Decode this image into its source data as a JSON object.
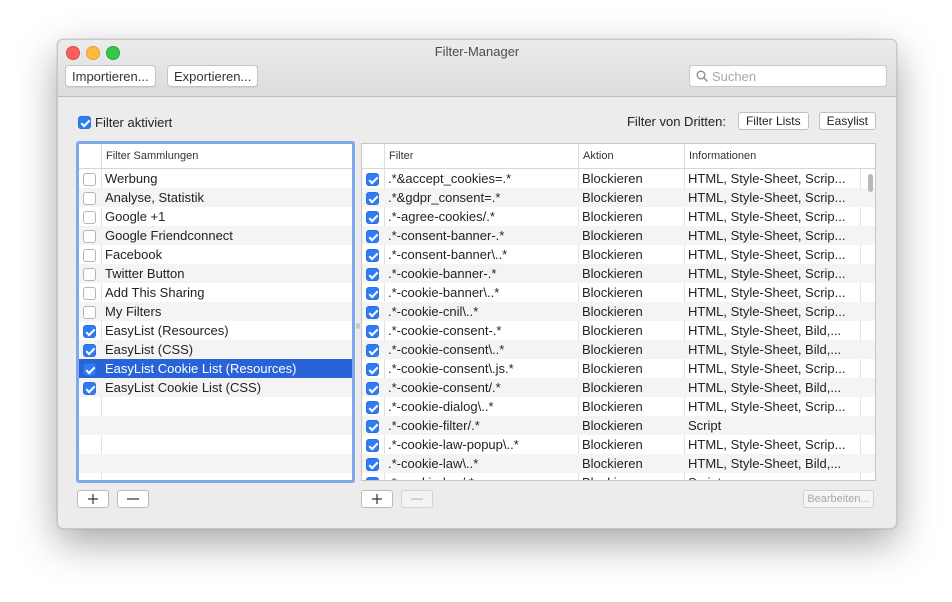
{
  "window": {
    "title": "Filter-Manager"
  },
  "toolbar": {
    "import_label": "Importieren...",
    "export_label": "Exportieren...",
    "search_placeholder": "Suchen"
  },
  "filter_enabled": {
    "label": "Filter aktiviert",
    "checked": true
  },
  "third_party": {
    "label": "Filter von Dritten:",
    "buttons": [
      "Filter Lists",
      "Easylist"
    ]
  },
  "collections": {
    "header": "Filter Sammlungen",
    "items": [
      {
        "label": "Werbung",
        "checked": false
      },
      {
        "label": "Analyse, Statistik",
        "checked": false
      },
      {
        "label": "Google +1",
        "checked": false
      },
      {
        "label": "Google Friendconnect",
        "checked": false
      },
      {
        "label": "Facebook",
        "checked": false
      },
      {
        "label": "Twitter Button",
        "checked": false
      },
      {
        "label": "Add This Sharing",
        "checked": false
      },
      {
        "label": "My Filters",
        "checked": false
      },
      {
        "label": "EasyList (Resources)",
        "checked": true
      },
      {
        "label": "EasyList (CSS)",
        "checked": true
      },
      {
        "label": "EasyList Cookie List (Resources)",
        "checked": true,
        "selected": true
      },
      {
        "label": "EasyList Cookie List (CSS)",
        "checked": true
      }
    ],
    "empty_rows": 5
  },
  "filters": {
    "columns": {
      "filter": "Filter",
      "action": "Aktion",
      "info": "Informationen"
    },
    "rows": [
      {
        "filter": ".*&accept_cookies=.*",
        "action": "Blockieren",
        "info": "HTML, Style-Sheet, Scrip..."
      },
      {
        "filter": ".*&gdpr_consent=.*",
        "action": "Blockieren",
        "info": "HTML, Style-Sheet, Scrip..."
      },
      {
        "filter": ".*-agree-cookies/.*",
        "action": "Blockieren",
        "info": "HTML, Style-Sheet, Scrip..."
      },
      {
        "filter": ".*-consent-banner-.*",
        "action": "Blockieren",
        "info": "HTML, Style-Sheet, Scrip..."
      },
      {
        "filter": ".*-consent-banner\\..*",
        "action": "Blockieren",
        "info": "HTML, Style-Sheet, Scrip..."
      },
      {
        "filter": ".*-cookie-banner-.*",
        "action": "Blockieren",
        "info": "HTML, Style-Sheet, Scrip..."
      },
      {
        "filter": ".*-cookie-banner\\..*",
        "action": "Blockieren",
        "info": "HTML, Style-Sheet, Scrip..."
      },
      {
        "filter": ".*-cookie-cnil\\..*",
        "action": "Blockieren",
        "info": "HTML, Style-Sheet, Scrip..."
      },
      {
        "filter": ".*-cookie-consent-.*",
        "action": "Blockieren",
        "info": "HTML, Style-Sheet, Bild,..."
      },
      {
        "filter": ".*-cookie-consent\\..*",
        "action": "Blockieren",
        "info": "HTML, Style-Sheet, Bild,..."
      },
      {
        "filter": ".*-cookie-consent\\.js.*",
        "action": "Blockieren",
        "info": "HTML, Style-Sheet, Scrip..."
      },
      {
        "filter": ".*-cookie-consent/.*",
        "action": "Blockieren",
        "info": "HTML, Style-Sheet, Bild,..."
      },
      {
        "filter": ".*-cookie-dialog\\..*",
        "action": "Blockieren",
        "info": "HTML, Style-Sheet, Scrip..."
      },
      {
        "filter": ".*-cookie-filter/.*",
        "action": "Blockieren",
        "info": "Script"
      },
      {
        "filter": ".*-cookie-law-popup\\..*",
        "action": "Blockieren",
        "info": "HTML, Style-Sheet, Scrip..."
      },
      {
        "filter": ".*-cookie-law\\..*",
        "action": "Blockieren",
        "info": "HTML, Style-Sheet, Bild,..."
      },
      {
        "filter": ".*-cookie-bar/.*",
        "action": "Blockieren",
        "info": "Script"
      }
    ]
  },
  "edit_label": "Bearbeiten..."
}
